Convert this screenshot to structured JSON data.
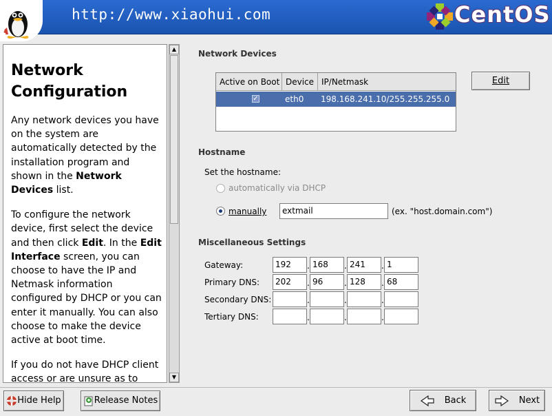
{
  "header": {
    "url": "http://www.xiaohui.com",
    "brand": "CentOS"
  },
  "help": {
    "title_line1": "Network",
    "title_line2": "Configuration",
    "paragraphs": [
      [
        {
          "t": "Any network devices you have on the system are automatically detected by the installation program and shown in the "
        },
        {
          "t": "Network Devices",
          "b": true
        },
        {
          "t": " list."
        }
      ],
      [
        {
          "t": "To configure the network device, first select the device and then click "
        },
        {
          "t": "Edit",
          "b": true
        },
        {
          "t": ". In the "
        },
        {
          "t": "Edit Interface",
          "b": true
        },
        {
          "t": " screen, you can choose to have the IP and Netmask information configured by DHCP or you can enter it manually. You can also choose to make the device active at boot time."
        }
      ],
      [
        {
          "t": "If you do not have DHCP client access or are unsure as to what this information is, please contact your network administrator."
        }
      ]
    ]
  },
  "network_devices": {
    "title": "Network Devices",
    "columns": [
      "Active on Boot",
      "Device",
      "IP/Netmask"
    ],
    "rows": [
      {
        "active": true,
        "device": "eth0",
        "ip": "198.168.241.10/255.255.255.0"
      }
    ],
    "edit_button": "Edit"
  },
  "hostname": {
    "title": "Hostname",
    "prompt": "Set the hostname:",
    "option_dhcp": "automatically via DHCP",
    "option_manual": "manually",
    "selected": "manual",
    "value": "extmail",
    "example": "(ex. \"host.domain.com\")"
  },
  "misc": {
    "title": "Miscellaneous Settings",
    "rows": [
      {
        "label": "Gateway:",
        "octets": [
          "192",
          "168",
          "241",
          "1"
        ]
      },
      {
        "label": "Primary DNS:",
        "octets": [
          "202",
          "96",
          "128",
          "68"
        ]
      },
      {
        "label": "Secondary DNS:",
        "octets": [
          "",
          "",
          "",
          ""
        ]
      },
      {
        "label": "Tertiary DNS:",
        "octets": [
          "",
          "",
          "",
          ""
        ]
      }
    ]
  },
  "footer": {
    "hide_help": "Hide Help",
    "release_notes": "Release Notes",
    "back": "Back",
    "next": "Next"
  }
}
